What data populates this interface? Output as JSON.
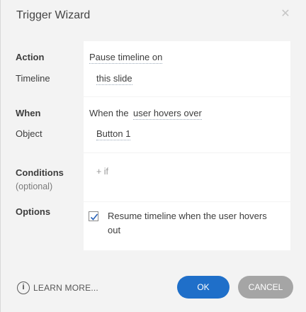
{
  "dialog": {
    "title": "Trigger Wizard",
    "close_icon": "close-icon"
  },
  "action": {
    "label": "Action",
    "value": "Pause timeline on"
  },
  "timeline": {
    "label": "Timeline",
    "value": "this slide"
  },
  "when": {
    "label": "When",
    "prefix": "When the",
    "value": "user hovers over"
  },
  "object": {
    "label": "Object",
    "value": "Button 1"
  },
  "conditions": {
    "label": "Conditions",
    "optional": "(optional)",
    "add": "+ if"
  },
  "options": {
    "label": "Options",
    "checkbox_checked": true,
    "checkbox_line1": "Resume timeline when the user hovers",
    "checkbox_line2": "out"
  },
  "footer": {
    "learn_icon": "info-circle-icon",
    "learn_more": "LEARN MORE...",
    "ok": "OK",
    "cancel": "CANCEL"
  },
  "colors": {
    "primary_button": "#1f6fc9",
    "secondary_button": "#a5a5a5",
    "background": "#f3f3f3"
  }
}
